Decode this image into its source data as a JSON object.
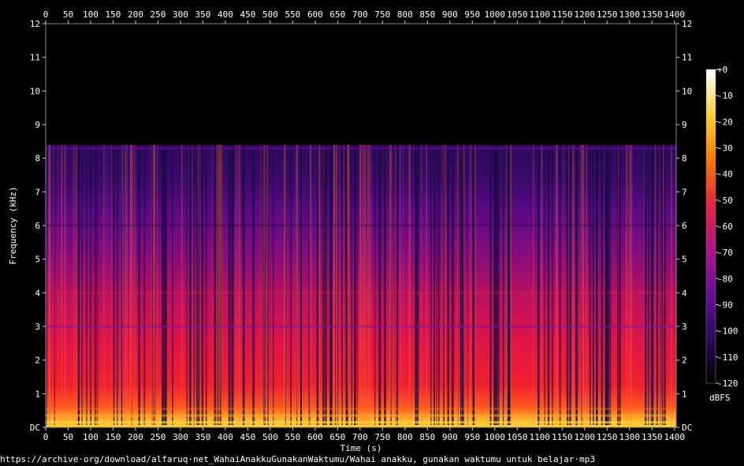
{
  "chart_data": {
    "type": "heatmap",
    "title": "",
    "xlabel": "Time (s)",
    "ylabel": "Frequency (kHz)",
    "xlim": [
      0,
      1404
    ],
    "ylim": [
      0,
      12
    ],
    "x_ticks": [
      "0",
      "50",
      "100",
      "150",
      "200",
      "250",
      "300",
      "350",
      "400",
      "450",
      "500",
      "550",
      "600",
      "650",
      "700",
      "750",
      "800",
      "850",
      "900",
      "950",
      "1000",
      "1050",
      "1100",
      "1150",
      "1200",
      "1250",
      "1300",
      "1350",
      "1400"
    ],
    "y_ticks": [
      "DC",
      "1",
      "2",
      "3",
      "4",
      "5",
      "6",
      "7",
      "8",
      "9",
      "10",
      "11",
      "12"
    ],
    "content_cutoff_khz": 8.4,
    "colorbar": {
      "label": "dBFS",
      "range": [
        -120,
        0
      ],
      "ticks": [
        "+0",
        "-10",
        "-20",
        "-30",
        "-40",
        "-50",
        "-60",
        "-70",
        "-80",
        "-90",
        "-100",
        "-110",
        "-120"
      ],
      "colormap": [
        "#000000",
        "#2a0a5e",
        "#6a0c9a",
        "#b3128e",
        "#e8233c",
        "#ff7a00",
        "#ffd23a",
        "#ffffff"
      ]
    }
  },
  "source_url": "https://archive·org/download/alfaruq·net_WahaiAnakkuGunakanWaktumu/Wahai anakku, gunakan waktumu untuk belajar·mp3"
}
